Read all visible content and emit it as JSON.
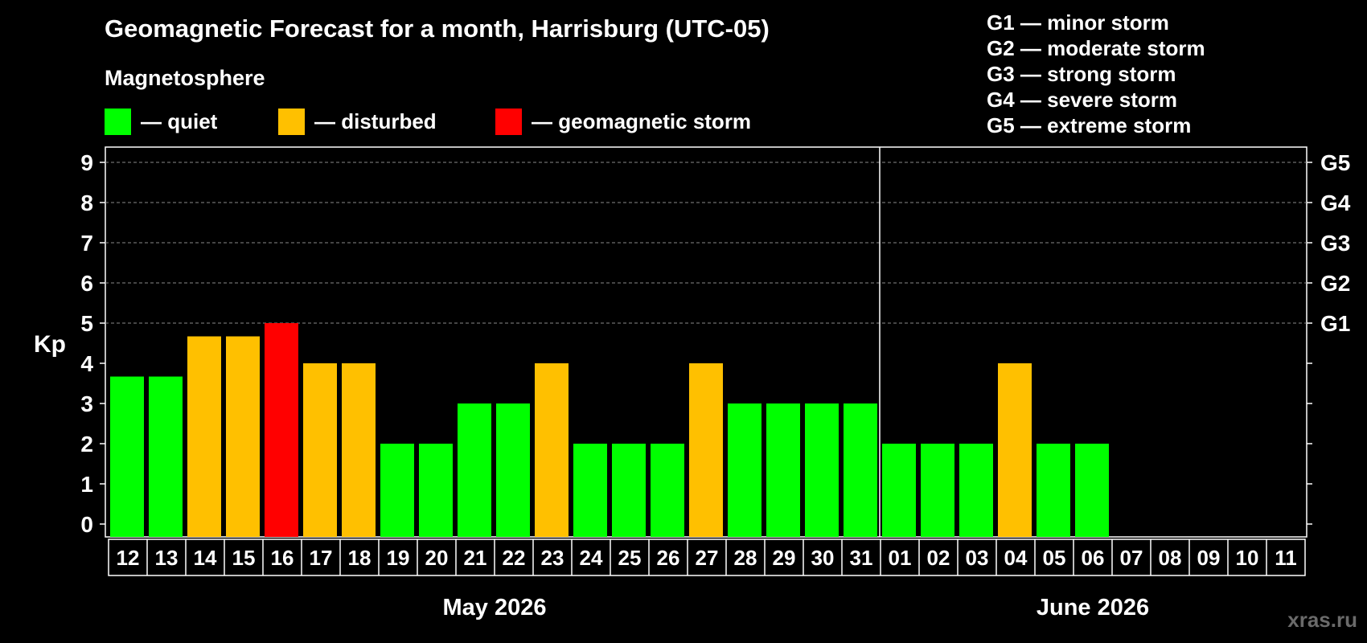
{
  "header": {
    "title": "Geomagnetic Forecast for a month, Harrisburg (UTC-05)",
    "subtitle": "Magnetosphere"
  },
  "legend": [
    {
      "label": "— quiet",
      "color": "#00ff00"
    },
    {
      "label": "— disturbed",
      "color": "#ffc000"
    },
    {
      "label": "— geomagnetic storm",
      "color": "#ff0000"
    }
  ],
  "storm_scale": [
    "G1 — minor storm",
    "G2 — moderate storm",
    "G3 — strong storm",
    "G4 — severe storm",
    "G5 — extreme storm"
  ],
  "watermark": "xras.ru",
  "chart_data": {
    "type": "bar",
    "ylabel": "Kp",
    "ylim": [
      0,
      9
    ],
    "yticks": [
      "0",
      "1",
      "2",
      "3",
      "4",
      "5",
      "6",
      "7",
      "8",
      "9"
    ],
    "right_axis_labels": [
      {
        "kp": 5,
        "label": "G1"
      },
      {
        "kp": 6,
        "label": "G2"
      },
      {
        "kp": 7,
        "label": "G3"
      },
      {
        "kp": 8,
        "label": "G4"
      },
      {
        "kp": 9,
        "label": "G5"
      }
    ],
    "grid": "dashed horizontal lines at Kp 5-9",
    "categories": [
      "12",
      "13",
      "14",
      "15",
      "16",
      "17",
      "18",
      "19",
      "20",
      "21",
      "22",
      "23",
      "24",
      "25",
      "26",
      "27",
      "28",
      "29",
      "30",
      "31",
      "01",
      "02",
      "03",
      "04",
      "05",
      "06",
      "07",
      "08",
      "09",
      "10",
      "11"
    ],
    "values": [
      3.67,
      3.67,
      4.67,
      4.67,
      5,
      4,
      4,
      2,
      2,
      3,
      3,
      4,
      2,
      2,
      2,
      4,
      3,
      3,
      3,
      3,
      2,
      2,
      2,
      4,
      2,
      2,
      null,
      null,
      null,
      null,
      null
    ],
    "status": [
      "quiet",
      "quiet",
      "disturbed",
      "disturbed",
      "storm",
      "disturbed",
      "disturbed",
      "quiet",
      "quiet",
      "quiet",
      "quiet",
      "disturbed",
      "quiet",
      "quiet",
      "quiet",
      "disturbed",
      "quiet",
      "quiet",
      "quiet",
      "quiet",
      "quiet",
      "quiet",
      "quiet",
      "disturbed",
      "quiet",
      "quiet",
      null,
      null,
      null,
      null,
      null
    ],
    "status_colors": {
      "quiet": "#00ff00",
      "disturbed": "#ffc000",
      "storm": "#ff0000"
    },
    "months": [
      {
        "label": "May 2026",
        "first_index": 0,
        "last_index": 19
      },
      {
        "label": "June 2026",
        "first_index": 20,
        "last_index": 30
      }
    ]
  }
}
